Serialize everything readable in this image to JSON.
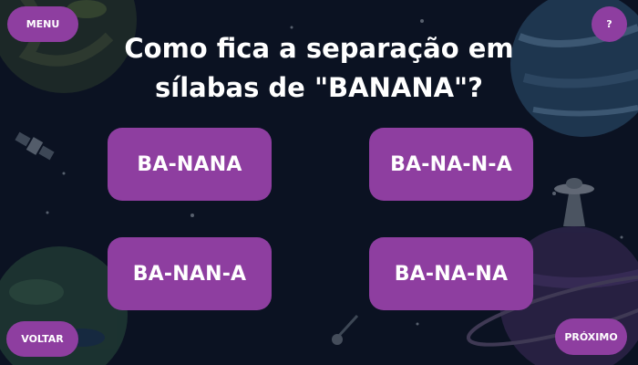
{
  "menu_label": "MENU",
  "help_label": "?",
  "question": {
    "line1": "Como fica a separação em",
    "line2": "sílabas de \"BANANA\"?"
  },
  "answers": [
    "BA-NANA",
    "BA-NA-N-A",
    "BA-NAN-A",
    "BA-NA-NA"
  ],
  "back_label": "VOLTAR",
  "next_label": "PRÓXIMO",
  "colors": {
    "background": "#0b1222",
    "button": "#8e3ea0",
    "text": "#ffffff"
  },
  "decorations": [
    "planet-icon",
    "satellite-icon",
    "ufo-icon",
    "comet-icon",
    "star-icon"
  ]
}
